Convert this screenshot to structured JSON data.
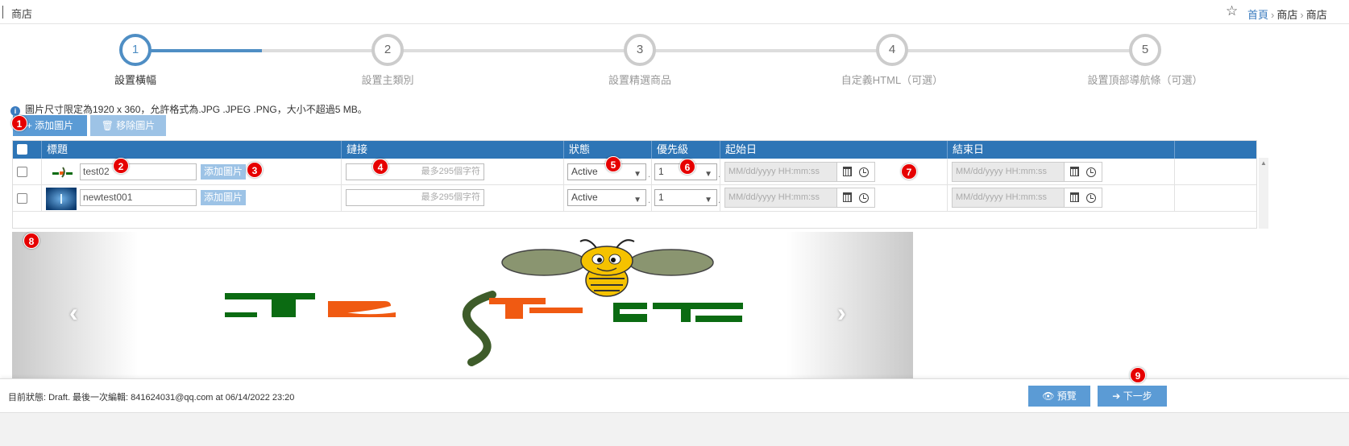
{
  "topbar": {
    "title": "商店",
    "breadcrumbs": [
      "首頁",
      "商店",
      "商店"
    ]
  },
  "steps": [
    {
      "num": "1",
      "label": "設置橫幅",
      "active": true
    },
    {
      "num": "2",
      "label": "設置主類別",
      "active": false
    },
    {
      "num": "3",
      "label": "設置精選商品",
      "active": false
    },
    {
      "num": "4",
      "label": "自定義HTML（可選）",
      "active": false
    },
    {
      "num": "5",
      "label": "設置頂部導航條（可選）",
      "active": false
    }
  ],
  "notice": "圖片尺寸限定為1920 x 360，允許格式為.JPG .JPEG .PNG，大小不超過5 MB。",
  "toolbar": {
    "add_label": "添加圖片",
    "remove_label": "移除圖片"
  },
  "table": {
    "headers": [
      "標題",
      "鏈接",
      "狀態",
      "優先級",
      "起始日",
      "結束日"
    ],
    "rows": [
      {
        "title": "test02",
        "upload_label": "添加圖片",
        "link_placeholder": "最多295個字符",
        "status": "Active",
        "priority": "1",
        "start_placeholder": "MM/dd/yyyy HH:mm:ss",
        "end_placeholder": "MM/dd/yyyy HH:mm:ss"
      },
      {
        "title": "newtest001",
        "upload_label": "添加圖片",
        "link_placeholder": "最多295個字符",
        "status": "Active",
        "priority": "1",
        "start_placeholder": "MM/dd/yyyy HH:mm:ss",
        "end_placeholder": "MM/dd/yyyy HH:mm:ss"
      }
    ]
  },
  "banner_logo": {
    "text": "TestHt",
    "colors": {
      "green": "#0b6b12",
      "orange": "#f05a12",
      "dark_green": "#3e5c2a"
    }
  },
  "footer": {
    "status_text": "目前狀態: Draft. 最後一次編輯: 841624031@qq.com at 06/14/2022 23:20",
    "preview_label": "預覽",
    "next_label": "下一步"
  },
  "annotations": [
    "1",
    "2",
    "3",
    "4",
    "5",
    "6",
    "7",
    "8",
    "9"
  ],
  "colors": {
    "accent": "#2e75b6",
    "button": "#5b9bd5",
    "button_light": "#9dc3e6",
    "badge": "#e60000"
  }
}
